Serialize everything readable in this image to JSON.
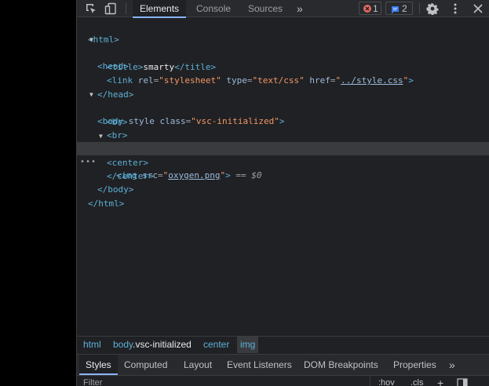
{
  "toolbar": {
    "tabs": [
      "Elements",
      "Console",
      "Sources"
    ],
    "more_tabs_glyph": "»",
    "error_count": "1",
    "message_count": "2",
    "icons": [
      "inspect-icon",
      "device-toolbar-icon",
      "error-icon",
      "message-icon",
      "gear-icon",
      "kebab-menu-icon",
      "close-icon"
    ]
  },
  "dom": {
    "html_open": "<html>",
    "head_open": "<head>",
    "title_open": "<title>",
    "title_text": "smarty",
    "title_close": "</title>",
    "link_tag": "<link",
    "link_rel_name": "rel",
    "link_rel_value": "\"stylesheet\"",
    "link_type_name": "type",
    "link_type_value": "\"text/css\"",
    "link_href_name": "href",
    "link_href_value": "../style.css",
    "head_close": "</head>",
    "body_tag": "<body",
    "body_style_attr": "style",
    "body_class_name": "class",
    "body_class_value": "\"vsc-initialized\"",
    "br1": "<br>",
    "br2": "<br>",
    "center_open": "<center>",
    "img_tag": "<img",
    "img_src_name": "src",
    "img_src_value": "oxygen.png",
    "selected_marker": "== $0",
    "dots": "•••",
    "center_close": "</center>",
    "body_close": "</body>",
    "html_close": "</html>"
  },
  "breadcrumbs": [
    {
      "tag": "html",
      "cls": ""
    },
    {
      "tag": "body",
      "cls": ".vsc-initialized"
    },
    {
      "tag": "center",
      "cls": ""
    },
    {
      "tag": "img",
      "cls": ""
    }
  ],
  "panel_tabs": [
    "Styles",
    "Computed",
    "Layout",
    "Event Listeners",
    "DOM Breakpoints",
    "Properties"
  ],
  "panel_more": "»",
  "filter": {
    "placeholder": "Filter",
    "hov": ":hov",
    "cls": ".cls"
  },
  "colors": {
    "accent": "#8ab4f8",
    "tag": "#5db0d7",
    "attr_value": "#f29766",
    "error": "#e46962"
  }
}
